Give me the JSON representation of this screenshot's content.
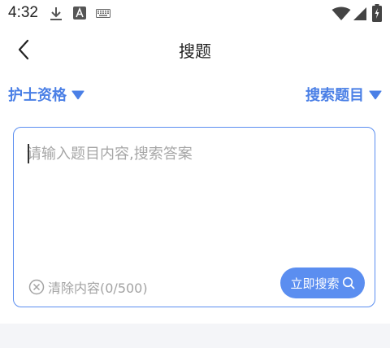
{
  "status_bar": {
    "time": "4:32",
    "icons": [
      "download-icon",
      "font-a-icon",
      "keyboard-icon",
      "wifi-icon",
      "signal-icon",
      "battery-charging-icon"
    ]
  },
  "nav": {
    "title": "搜题",
    "back_icon": "chevron-left-icon"
  },
  "filters": {
    "category_label": "护士资格",
    "mode_label": "搜索题目",
    "accent_color": "#4a7fe6"
  },
  "search": {
    "placeholder": "请输入题目内容,搜索答案",
    "value": "",
    "clear_label": "清除内容(0/500)",
    "submit_label": "立即搜索",
    "border_color": "#5b8ef0",
    "button_color": "#5b8ef0"
  }
}
